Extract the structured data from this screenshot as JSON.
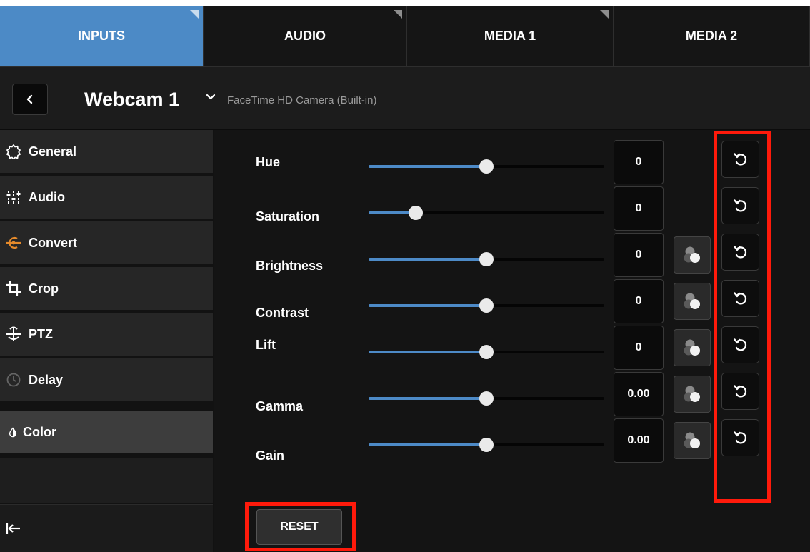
{
  "tabs": [
    {
      "label": "INPUTS",
      "active": true
    },
    {
      "label": "AUDIO",
      "active": false
    },
    {
      "label": "MEDIA 1",
      "active": false
    },
    {
      "label": "MEDIA 2",
      "active": false
    }
  ],
  "header": {
    "input_name": "Webcam 1",
    "device_name": "FaceTime HD Camera (Built-in)"
  },
  "sidebar": {
    "items": [
      {
        "label": "General",
        "icon": "gear-icon"
      },
      {
        "label": "Audio",
        "icon": "mixer-icon"
      },
      {
        "label": "Convert",
        "icon": "convert-icon"
      },
      {
        "label": "Crop",
        "icon": "crop-icon"
      },
      {
        "label": "PTZ",
        "icon": "ptz-icon"
      },
      {
        "label": "Delay",
        "icon": "clock-icon"
      },
      {
        "label": "Color",
        "icon": "color-drop-icon",
        "active": true
      }
    ]
  },
  "color": {
    "rows": [
      {
        "label": "Hue",
        "value": "0",
        "level": 0.5,
        "scope": false
      },
      {
        "label": "Saturation",
        "value": "0",
        "level": 0.2,
        "scope": false
      },
      {
        "label": "Brightness",
        "value": "0",
        "level": 0.5,
        "scope": true
      },
      {
        "label": "Contrast",
        "value": "0",
        "level": 0.5,
        "scope": true
      },
      {
        "label": "Lift",
        "value": "0",
        "level": 0.5,
        "scope": true
      },
      {
        "label": "Gamma",
        "value": "0.00",
        "level": 0.5,
        "scope": true
      },
      {
        "label": "Gain",
        "value": "0.00",
        "level": 0.5,
        "scope": true
      }
    ],
    "reset_label": "RESET"
  },
  "colors": {
    "accent": "#4c8ac6",
    "highlight": "#ff1a0b",
    "convert_icon": "#e58a2b"
  }
}
